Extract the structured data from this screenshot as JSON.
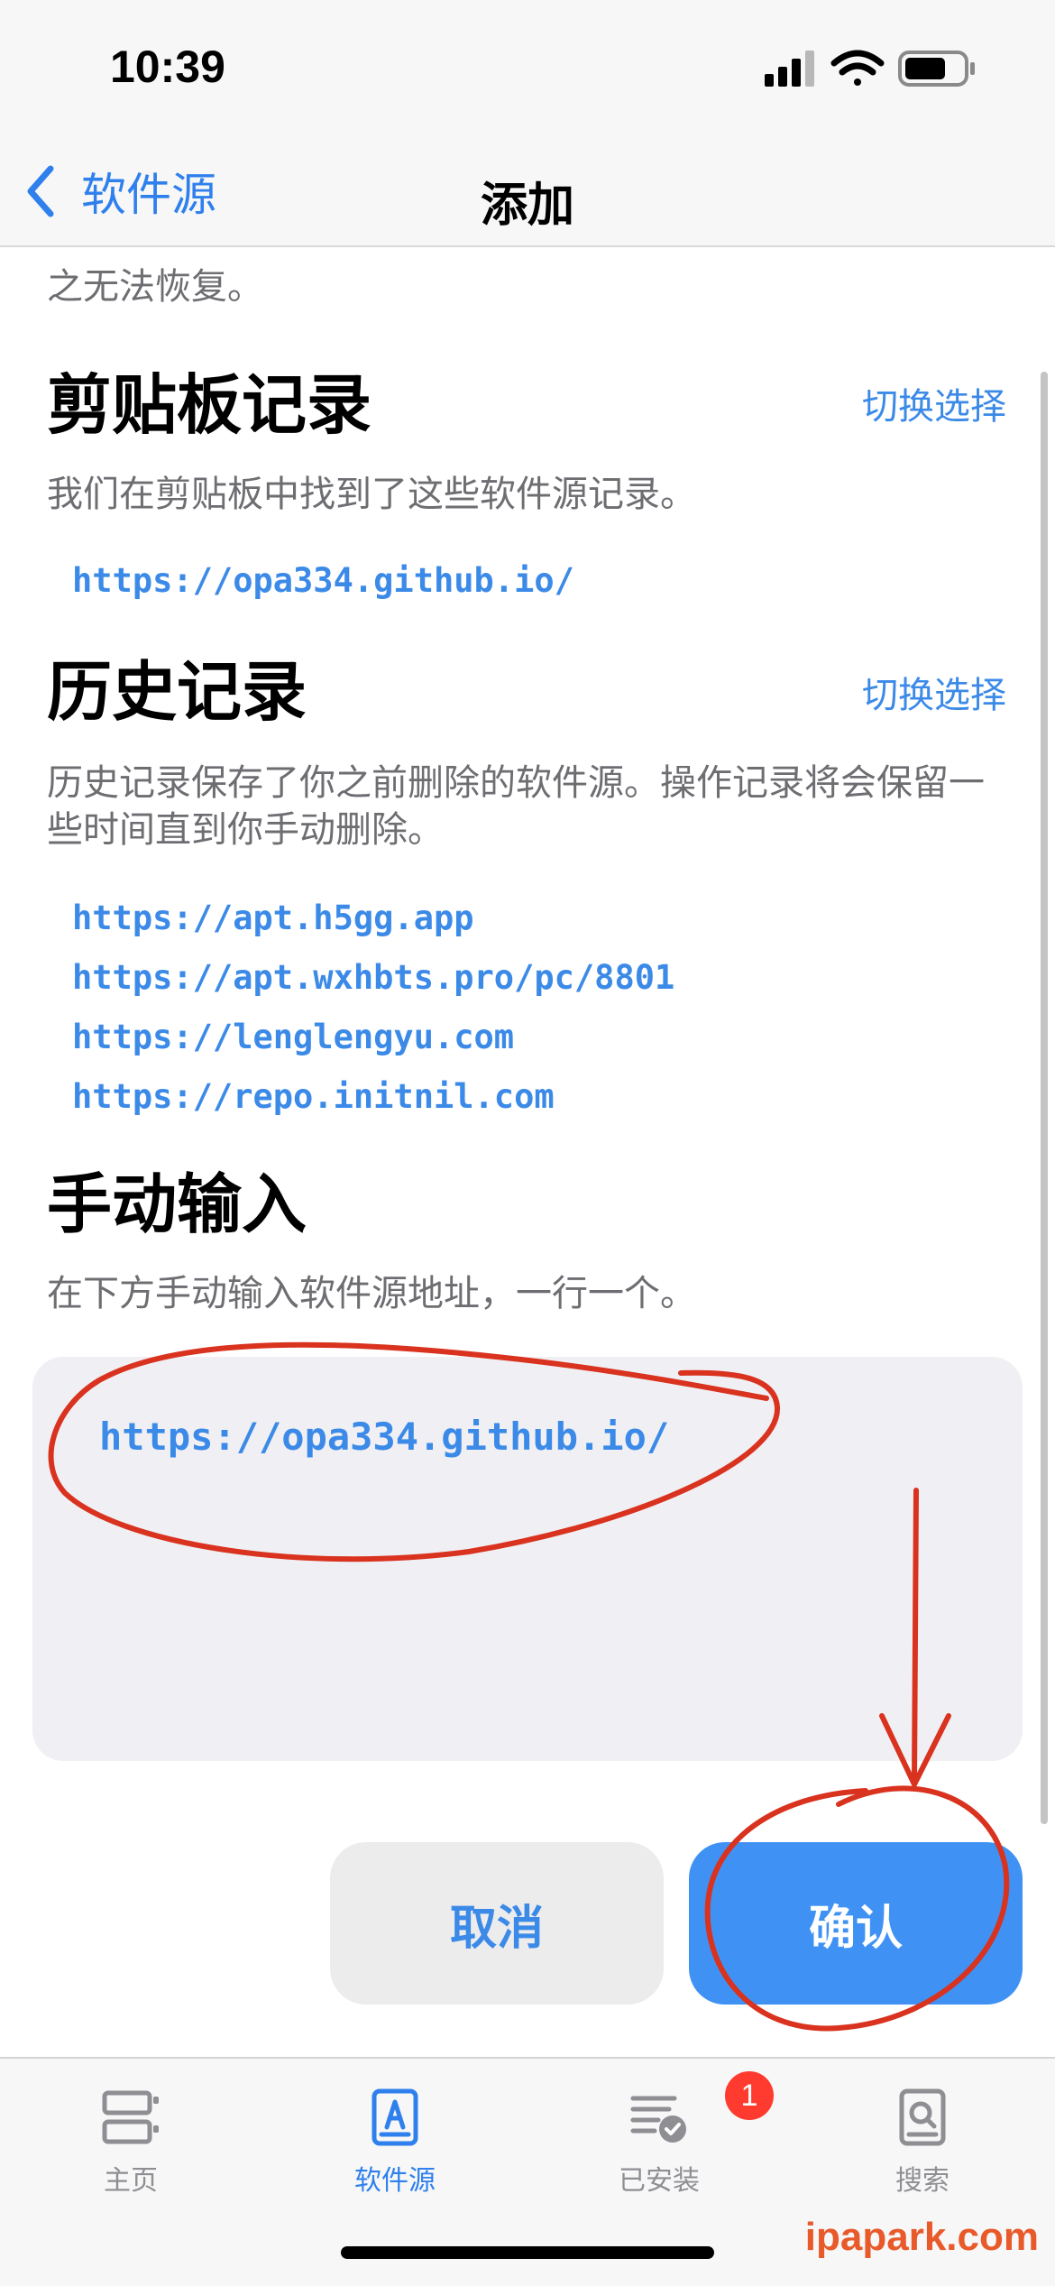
{
  "status": {
    "time": "10:39"
  },
  "nav": {
    "back_label": "软件源",
    "title": "添加"
  },
  "cut_text": "之无法恢复。",
  "clipboard": {
    "title": "剪贴板记录",
    "toggle": "切换选择",
    "desc": "我们在剪贴板中找到了这些软件源记录。",
    "links": [
      "https://opa334.github.io/"
    ]
  },
  "history": {
    "title": "历史记录",
    "toggle": "切换选择",
    "desc": "历史记录保存了你之前删除的软件源。操作记录将会保留一些时间直到你手动删除。",
    "links": [
      "https://apt.h5gg.app",
      "https://apt.wxhbts.pro/pc/8801",
      "https://lenglengyu.com",
      "https://repo.initnil.com"
    ]
  },
  "manual": {
    "title": "手动输入",
    "desc": "在下方手动输入软件源地址，一行一个。",
    "value": "https://opa334.github.io/"
  },
  "buttons": {
    "cancel": "取消",
    "confirm": "确认"
  },
  "tabs": [
    {
      "label": "主页",
      "icon": "home-icon"
    },
    {
      "label": "软件源",
      "icon": "sources-icon"
    },
    {
      "label": "已安装",
      "icon": "installed-icon",
      "badge": "1"
    },
    {
      "label": "搜索",
      "icon": "search-icon"
    }
  ],
  "watermark": "ipapark.com",
  "colors": {
    "accent": "#3c8ae8",
    "confirm_button": "#3f92f3",
    "badge": "#ff3b30",
    "annotation": "#d9321f"
  }
}
